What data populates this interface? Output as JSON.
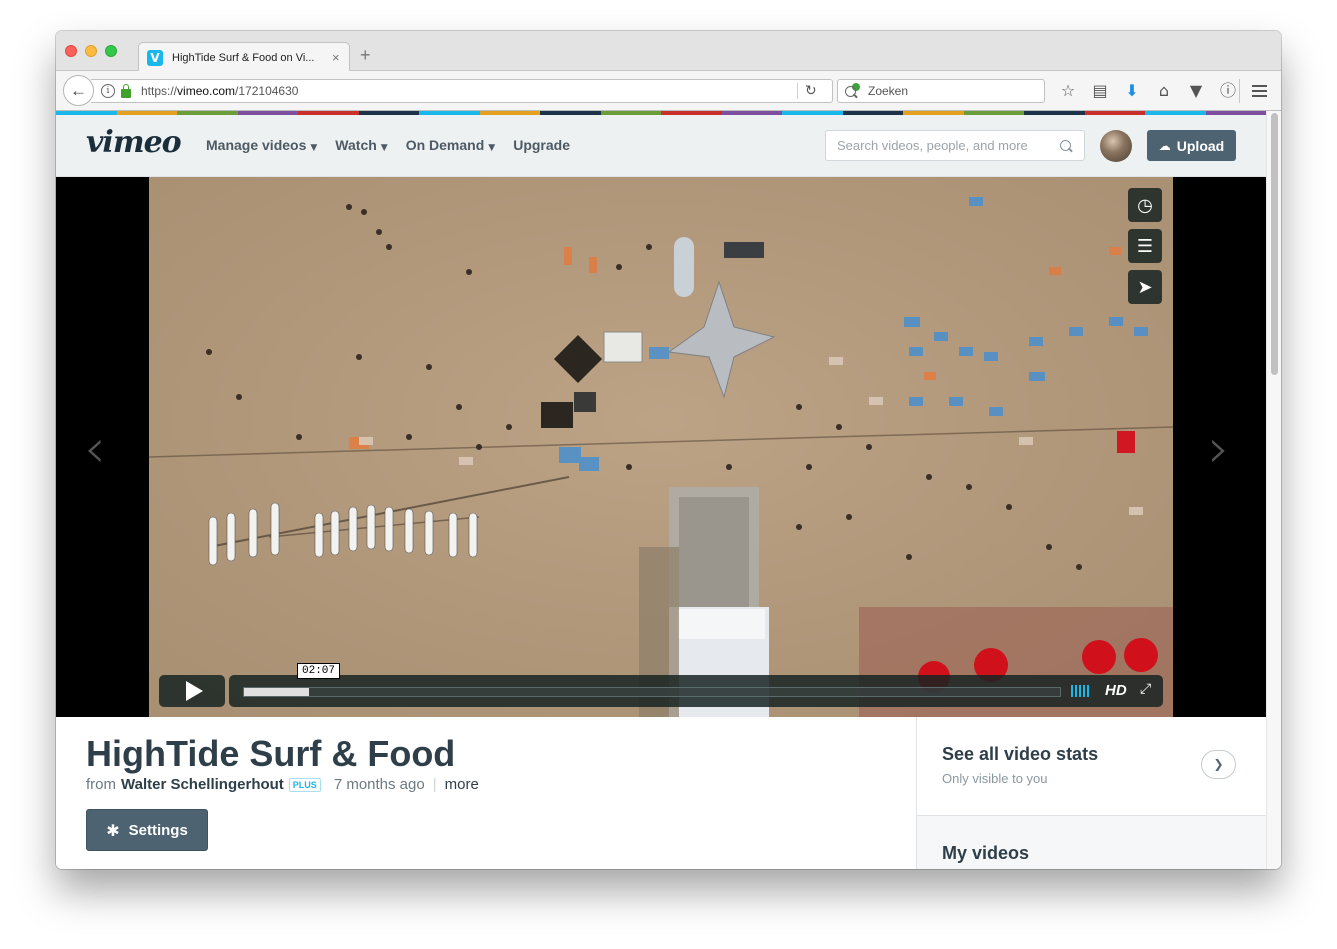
{
  "browser": {
    "tab_title": "HighTide Surf & Food on Vi...",
    "tab_favicon": "V",
    "tab_close": "×",
    "new_tab": "+",
    "url_prefix": "https://",
    "url_host": "vimeo.com",
    "url_path": "/172104630",
    "search_placeholder": "Zoeken",
    "icons": [
      "star-icon",
      "reading-list-icon",
      "download-icon",
      "home-icon",
      "pocket-icon",
      "info-icon",
      "menu-icon"
    ]
  },
  "stripe_colors": [
    "#1ab7ea",
    "#e4a122",
    "#6b9e3a",
    "#7d4f9e",
    "#c9302c",
    "#1d334a",
    "#1ab7ea",
    "#e4a122",
    "#1d334a",
    "#6b9e3a",
    "#c9302c",
    "#7d4f9e",
    "#1ab7ea",
    "#1d334a",
    "#e4a122",
    "#6b9e3a",
    "#1d334a",
    "#c9302c",
    "#1ab7ea",
    "#7d4f9e"
  ],
  "header": {
    "logo": "vimeo",
    "nav": [
      {
        "label": "Manage videos",
        "dropdown": true
      },
      {
        "label": "Watch",
        "dropdown": true
      },
      {
        "label": "On Demand",
        "dropdown": true
      },
      {
        "label": "Upgrade",
        "dropdown": false
      }
    ],
    "search_placeholder": "Search videos, people, and more",
    "upload_label": "Upload"
  },
  "player": {
    "timecode": "02:07",
    "progress": 0.08,
    "hd_label": "HD",
    "side_buttons": [
      "clock-icon",
      "layers-icon",
      "share-icon"
    ]
  },
  "video_info": {
    "title": "HighTide Surf & Food",
    "from_label": "from",
    "author": "Walter Schellingerhout",
    "badge": "PLUS",
    "age": "7 months ago",
    "more_label": "more",
    "settings_label": "Settings"
  },
  "sidebar": {
    "stats_title": "See all video stats",
    "stats_sub": "Only visible to you",
    "myvideos_title": "My videos"
  },
  "accent": "#1ab7ea",
  "button_color": "#4e6372"
}
